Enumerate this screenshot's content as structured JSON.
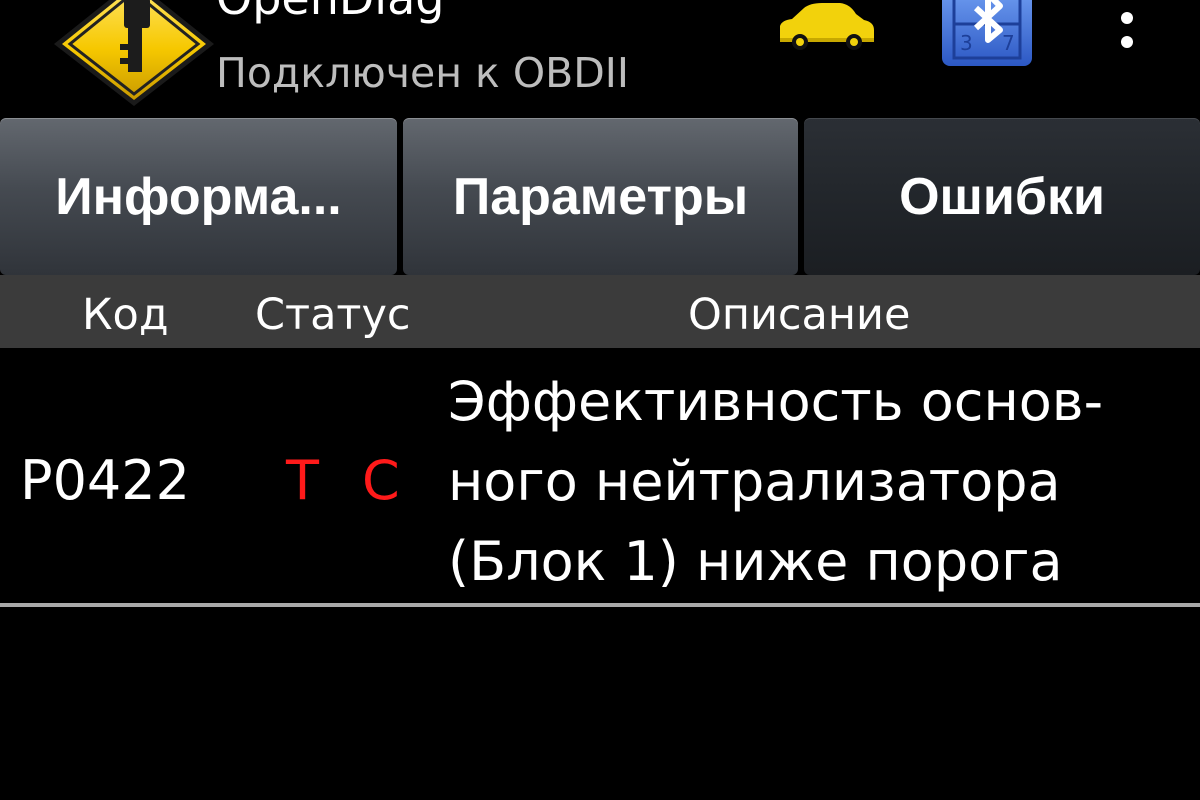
{
  "app": {
    "title": "OpenDiag",
    "subtitle": "Подключен к OBDII",
    "logo_icon": "key-road-sign-icon",
    "brand_color": "#f6c800"
  },
  "actions": {
    "car_icon": "car-icon",
    "car_color": "#f2d20c",
    "bluetooth_icon": "bluetooth-icon",
    "bluetooth_color": "#3a6fd8",
    "overflow_icon": "overflow-menu-icon"
  },
  "tabs": [
    {
      "label": "Информа...",
      "active": false
    },
    {
      "label": "Параметры",
      "active": false
    },
    {
      "label": "Ошибки",
      "active": true
    }
  ],
  "table": {
    "headers": {
      "code": "Код",
      "status": "Статус",
      "description": "Описание"
    },
    "rows": [
      {
        "code": "P0422",
        "status": [
          "T",
          "C"
        ],
        "status_color": "#ff1a1a",
        "description_lines": [
          "Эффективность основ-",
          "ного нейтрализатора",
          "(Блок 1) ниже порога"
        ]
      }
    ]
  }
}
